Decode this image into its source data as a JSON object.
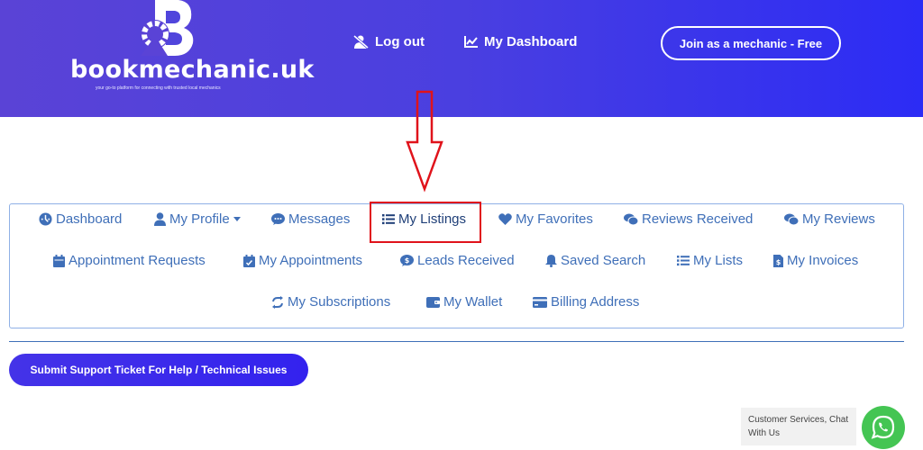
{
  "header": {
    "logo_text": "bookmechanic.uk",
    "logo_tagline": "your go-to platform for connecting with trusted local mechanics",
    "logout_label": "Log out",
    "dashboard_label": "My Dashboard",
    "join_label": "Join as a mechanic - Free"
  },
  "menu": {
    "dashboard": "Dashboard",
    "my_profile": "My Profile",
    "messages": "Messages",
    "my_listings": "My Listings",
    "my_favorites": "My Favorites",
    "reviews_received": "Reviews Received",
    "my_reviews": "My Reviews",
    "appointment_requests": "Appointment Requests",
    "my_appointments": "My Appointments",
    "leads_received": "Leads Received",
    "saved_search": "Saved Search",
    "my_lists": "My Lists",
    "my_invoices": "My Invoices",
    "my_subscriptions": "My Subscriptions",
    "my_wallet": "My Wallet",
    "billing_address": "Billing Address"
  },
  "support": {
    "label": "Submit Support Ticket For Help / Technical Issues"
  },
  "chat": {
    "label": "Customer Services, Chat With Us"
  },
  "colors": {
    "header_start": "#5a43d6",
    "header_end": "#2c2cf5",
    "menu_text": "#3f6fb8",
    "highlight": "#e0131b",
    "whatsapp": "#44c553"
  }
}
